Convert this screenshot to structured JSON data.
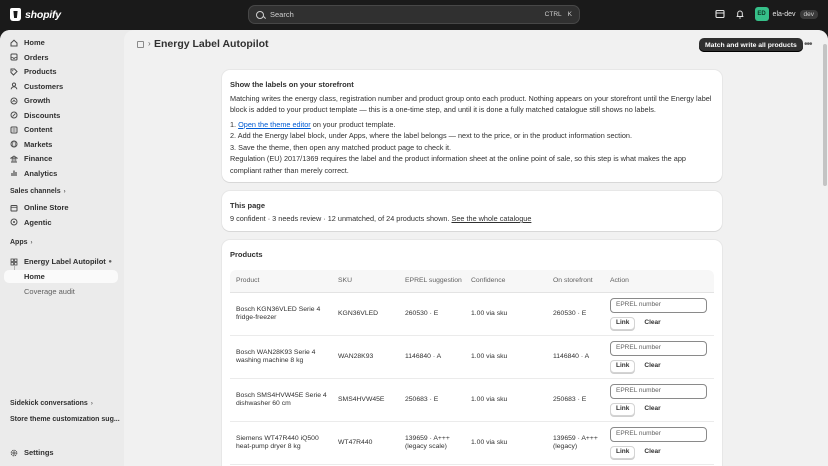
{
  "topbar": {
    "brand": "shopify",
    "search_placeholder": "Search",
    "shortcut_ctrl": "CTRL",
    "shortcut_key": "K",
    "store_initials": "ED",
    "store_name": "ela-dev",
    "store_badge": "dev"
  },
  "sidebar": {
    "nav": [
      "Home",
      "Orders",
      "Products",
      "Customers",
      "Growth",
      "Discounts",
      "Content",
      "Markets",
      "Finance",
      "Analytics"
    ],
    "sales_channels_label": "Sales channels",
    "channels": [
      "Online Store",
      "Agentic"
    ],
    "apps_label": "Apps",
    "app_name": "Energy Label Autopilot",
    "app_pages": [
      "Home",
      "Coverage audit"
    ],
    "bottom": [
      "Sidekick conversations",
      "Store theme customization sug..."
    ],
    "settings": "Settings"
  },
  "page": {
    "title": "Energy Label Autopilot",
    "primary_action": "Match and write all products"
  },
  "card_show": {
    "heading": "Show the labels on your storefront",
    "intro": "Matching writes the energy class, registration number and product group onto each product. Nothing appears on your storefront until the Energy label block is added to your product template — this is a one-time step, and until it is done a fully matched catalogue still shows no labels.",
    "step1_link": "Open the theme editor",
    "step1_rest": " on your product template.",
    "step2": "2. Add the Energy label block, under Apps, where the label belongs — next to the price, or in the product information section.",
    "step3": "3. Save the theme, then open any matched product page to check it.",
    "regulation": "Regulation (EU) 2017/1369 requires the label and the product information sheet at the online point of sale, so this step is what makes the app compliant rather than merely correct."
  },
  "card_page": {
    "heading": "This page",
    "summary": "9 confident · 3 needs review · 12 unmatched, of 24 products shown. ",
    "catalogue_link": "See the whole catalogue"
  },
  "products": {
    "heading": "Products",
    "columns": [
      "Product",
      "SKU",
      "EPREL suggestion",
      "Confidence",
      "On storefront",
      "Action"
    ],
    "input_placeholder": "EPREL number",
    "link_label": "Link",
    "clear_label": "Clear",
    "rows": [
      {
        "product": "Bosch KGN36VLED Serie 4 fridge-freezer",
        "sku": "KGN36VLED",
        "suggestion": "260530 · E",
        "confidence": "1.00 via sku",
        "storefront": "260530 · E"
      },
      {
        "product": "Bosch WAN28K93 Serie 4 washing machine 8 kg",
        "sku": "WAN28K93",
        "suggestion": "1146840 · A",
        "confidence": "1.00 via sku",
        "storefront": "1146840 · A"
      },
      {
        "product": "Bosch SMS4HVW45E Serie 4 dishwasher 60 cm",
        "sku": "SMS4HVW45E",
        "suggestion": "250683 · E",
        "confidence": "1.00 via sku",
        "storefront": "250683 · E"
      },
      {
        "product": "Siemens WT47R440 iQ500 heat-pump dryer 8 kg",
        "sku": "WT47R440",
        "suggestion": "139659 · A+++ (legacy scale)",
        "confidence": "1.00 via sku",
        "storefront": "139659 · A+++ (legacy)"
      }
    ]
  }
}
